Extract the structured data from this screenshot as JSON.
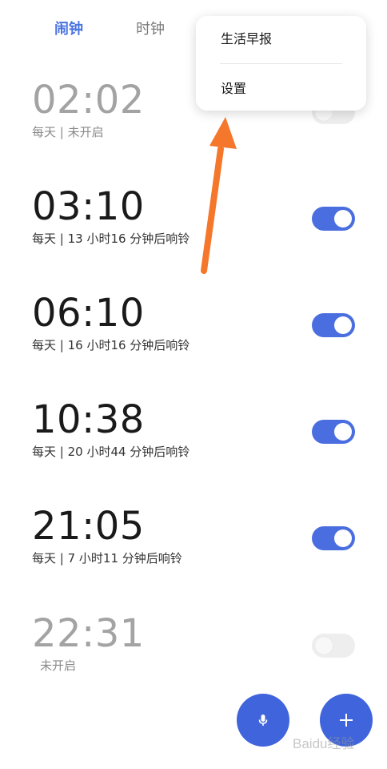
{
  "tabs": [
    {
      "label": "闹钟",
      "active": true
    },
    {
      "label": "时钟",
      "active": false
    }
  ],
  "menu": {
    "items": [
      "生活早报",
      "设置"
    ]
  },
  "alarms": [
    {
      "time": "02:02",
      "subtitle": "每天 | 未开启",
      "enabled": false
    },
    {
      "time": "03:10",
      "subtitle": "每天 | 13 小时16 分钟后响铃",
      "enabled": true
    },
    {
      "time": "06:10",
      "subtitle": "每天 | 16 小时16 分钟后响铃",
      "enabled": true
    },
    {
      "time": "10:38",
      "subtitle": "每天 | 20 小时44 分钟后响铃",
      "enabled": true
    },
    {
      "time": "21:05",
      "subtitle": "每天 | 7 小时11 分钟后响铃",
      "enabled": true
    },
    {
      "time": "22:31",
      "subtitle": "未开启",
      "enabled": false
    }
  ],
  "fabs": {
    "voice_icon": "microphone-icon",
    "add_icon": "plus-icon"
  },
  "watermark": {
    "text": "Baidu经验"
  },
  "colors": {
    "accent": "#4a74e0",
    "toggle_on": "#4a6ee0",
    "fab": "#3f64dc",
    "arrow": "#f5772b"
  }
}
